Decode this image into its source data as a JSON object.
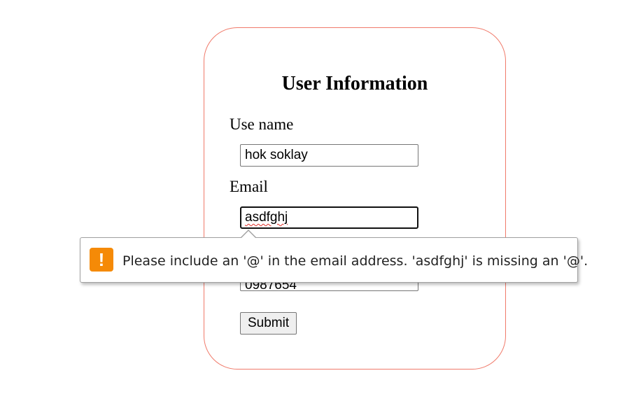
{
  "form": {
    "title": "User Information",
    "username_label": "Use name",
    "username_value": "hok soklay",
    "email_label": "Email",
    "email_value": "asdfghj",
    "phone_value": "0987654",
    "submit_label": "Submit"
  },
  "validation_tooltip": {
    "icon": "warning-icon",
    "icon_glyph": "!",
    "icon_color": "#f58a07",
    "message": "Please include an '@' in the email address. 'asdfghj' is missing an '@'."
  },
  "colors": {
    "card_border": "#f07a6a"
  }
}
